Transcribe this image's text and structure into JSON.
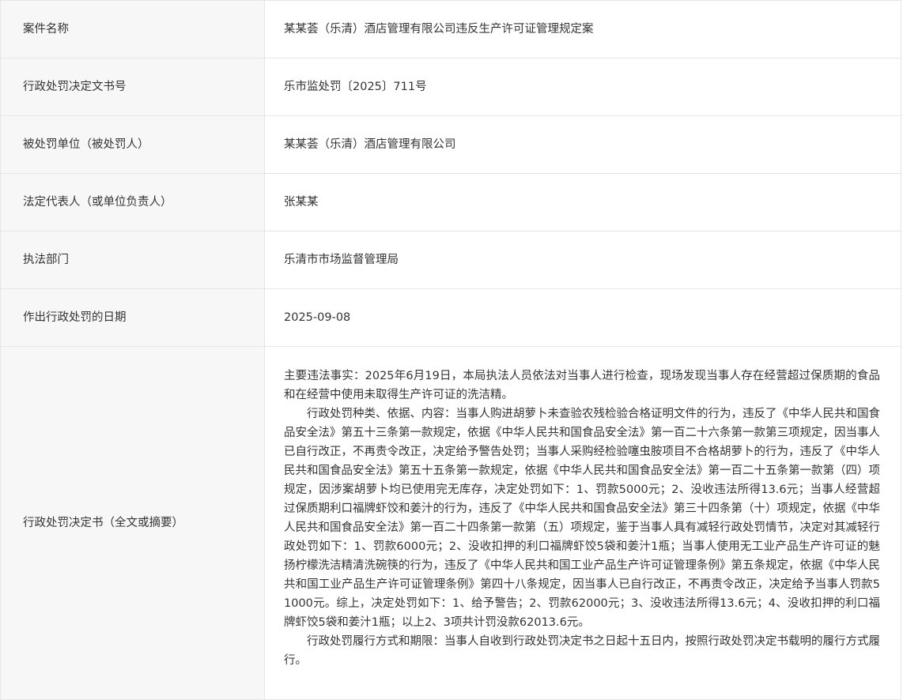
{
  "rows": [
    {
      "label": "案件名称",
      "value": "某某荟（乐清）酒店管理有限公司违反生产许可证管理规定案"
    },
    {
      "label": "行政处罚决定文书号",
      "value": "乐市监处罚〔2025〕711号"
    },
    {
      "label": "被处罚单位（被处罚人）",
      "value": "某某荟（乐清）酒店管理有限公司"
    },
    {
      "label": "法定代表人（或单位负责人）",
      "value": "张某某"
    },
    {
      "label": "执法部门",
      "value": "乐清市市场监督管理局"
    },
    {
      "label": "作出行政处罚的日期",
      "value": "2025-09-08"
    }
  ],
  "decision": {
    "label": "行政处罚决定书（全文或摘要）",
    "paragraphs": [
      "主要违法事实：2025年6月19日，本局执法人员依法对当事人进行检查，现场发现当事人存在经营超过保质期的食品和在经营中使用未取得生产许可证的洗洁精。",
      "行政处罚种类、依据、内容：当事人购进胡萝卜未查验农残检验合格证明文件的行为，违反了《中华人民共和国食品安全法》第五十三条第一款规定，依据《中华人民共和国食品安全法》第一百二十六条第一款第三项规定，因当事人已自行改正，不再责令改正，决定给予警告处罚；当事人采购经检验噻虫胺项目不合格胡萝卜的行为，违反了《中华人民共和国食品安全法》第五十五条第一款规定，依据《中华人民共和国食品安全法》第一百二十五条第一款第（四）项规定，因涉案胡萝卜均已使用完无库存，决定处罚如下：1、罚款5000元；2、没收违法所得13.6元；当事人经营超过保质期利口福牌虾饺和姜汁的行为，违反了《中华人民共和国食品安全法》第三十四条第（十）项规定，依据《中华人民共和国食品安全法》第一百二十四条第一款第（五）项规定，鉴于当事人具有减轻行政处罚情节，决定对其减轻行政处罚如下：1、罚款6000元；2、没收扣押的利口福牌虾饺5袋和姜汁1瓶；当事人使用无工业产品生产许可证的魅扬柠檬洗洁精清洗碗筷的行为，违反了《中华人民共和国工业产品生产许可证管理条例》第五条规定，依据《中华人民共和国工业产品生产许可证管理条例》第四十八条规定，因当事人已自行改正，不再责令改正，决定给予当事人罚款51000元。综上，决定处罚如下：1、给予警告；2、罚款62000元；3、没收违法所得13.6元；4、没收扣押的利口福牌虾饺5袋和姜汁1瓶；以上2、3项共计罚没款62013.6元。",
      "行政处罚履行方式和期限：当事人自收到行政处罚决定书之日起十五日内，按照行政处罚决定书载明的履行方式履行。"
    ]
  }
}
